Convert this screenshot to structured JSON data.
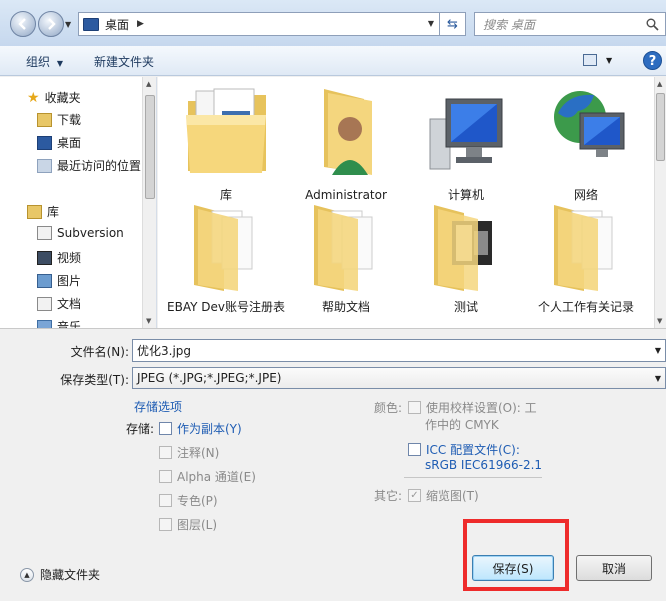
{
  "address_bar": {
    "location": "桌面",
    "search_placeholder": "搜索 桌面"
  },
  "toolbar": {
    "organize": "组织",
    "new_folder": "新建文件夹"
  },
  "nav": {
    "favorites": "收藏夹",
    "items_fav": [
      "下载",
      "桌面",
      "最近访问的位置"
    ],
    "library": "库",
    "items_lib": [
      "Subversion",
      "视频",
      "图片",
      "文档",
      "音乐"
    ]
  },
  "files": [
    {
      "label": "库",
      "icon": "library-icon"
    },
    {
      "label": "Administrator",
      "icon": "user-folder-icon"
    },
    {
      "label": "计算机",
      "icon": "computer-icon"
    },
    {
      "label": "网络",
      "icon": "network-icon"
    },
    {
      "label": "EBAY Dev账号注册表",
      "icon": "folder-icon"
    },
    {
      "label": "帮助文档",
      "icon": "folder-icon"
    },
    {
      "label": "测试",
      "icon": "folder-icon"
    },
    {
      "label": "个人工作有关记录",
      "icon": "folder-icon"
    }
  ],
  "form": {
    "filename_label": "文件名(N):",
    "filename_value": "优化3.jpg",
    "filetype_label": "保存类型(T):",
    "filetype_value": "JPEG (*.JPG;*.JPEG;*.JPE)",
    "storage_options": "存储选项",
    "storage_label": "存储:",
    "as_copy": "作为副本(Y)",
    "notes": "注释(N)",
    "alpha": "Alpha 通道(E)",
    "spot": "专色(P)",
    "layers": "图层(L)",
    "color_label": "颜色:",
    "proof_line1": "使用校样设置(O): 工",
    "proof_line2": "作中的 CMYK",
    "icc_line1": "ICC 配置文件(C):",
    "icc_line2": "sRGB IEC61966-2.1",
    "other_label": "其它:",
    "thumbnail": "缩览图(T)",
    "hide_folders": "隐藏文件夹",
    "save": "保存(S)",
    "cancel": "取消"
  },
  "colors": {
    "highlight": "#ee2b2b",
    "link": "#1e5cb3",
    "folder": "#f1d27a"
  }
}
